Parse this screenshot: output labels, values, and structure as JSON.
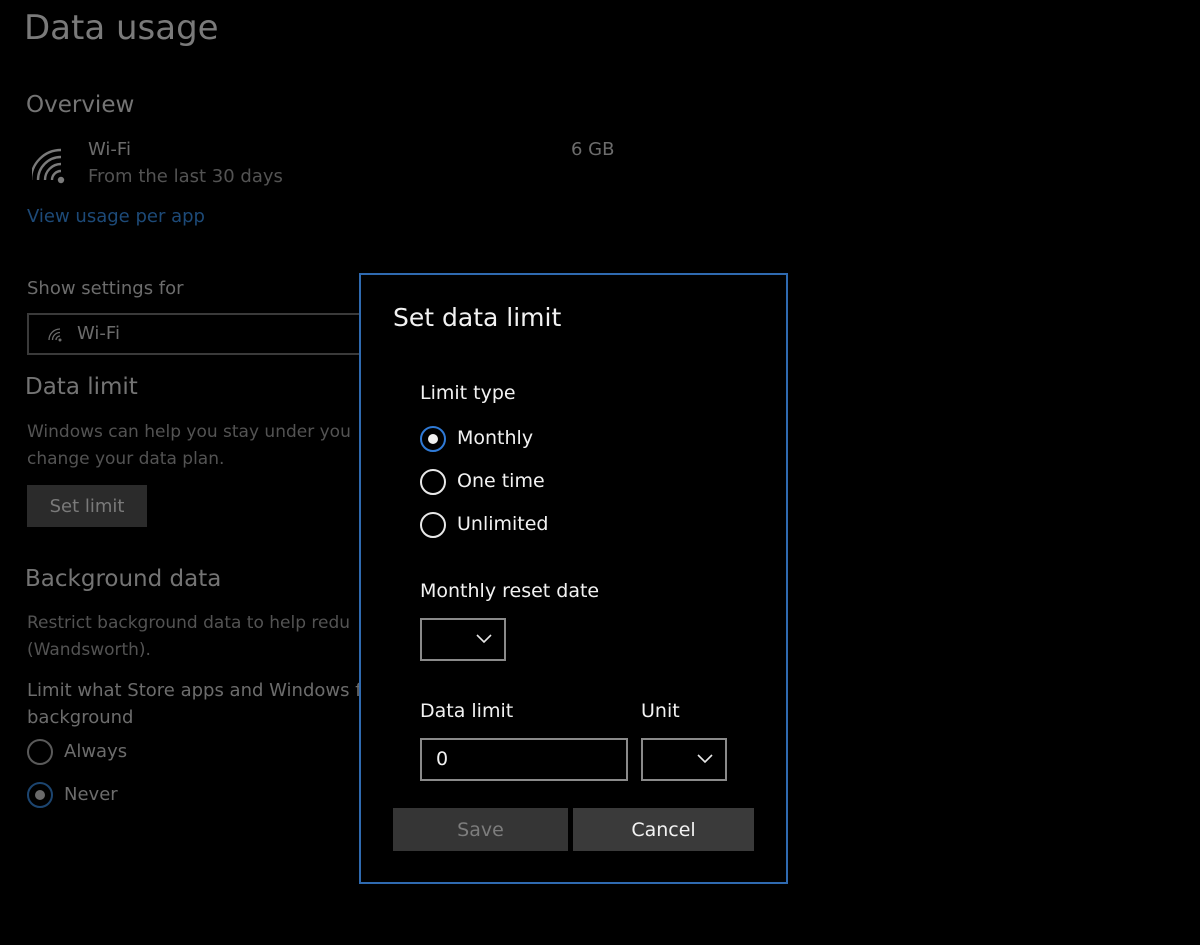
{
  "page": {
    "title": "Data usage",
    "overview_heading": "Overview",
    "wifi_name": "Wi-Fi",
    "wifi_period": "From the last 30 days",
    "wifi_usage": "6 GB",
    "view_usage_link": "View usage per app",
    "show_settings_label": "Show settings for",
    "network_dropdown_value": "Wi-Fi",
    "data_limit_heading": "Data limit",
    "data_limit_desc_line1": "Windows can help you stay under you",
    "data_limit_desc_line2": "change your data plan.",
    "set_limit_label": "Set limit",
    "background_heading": "Background data",
    "background_desc_line1": "Restrict background data to help redu",
    "background_desc_line2": "(Wandsworth).",
    "limit_store_line1": "Limit what Store apps and Windows fe",
    "limit_store_line2": "background",
    "options": [
      {
        "label": "Always",
        "checked": false
      },
      {
        "label": "Never",
        "checked": true
      }
    ]
  },
  "dialog": {
    "title": "Set data limit",
    "limit_type_label": "Limit type",
    "limit_types": [
      {
        "label": "Monthly",
        "checked": true
      },
      {
        "label": "One time",
        "checked": false
      },
      {
        "label": "Unlimited",
        "checked": false
      }
    ],
    "reset_date_label": "Monthly reset date",
    "reset_date_value": "",
    "data_limit_label": "Data limit",
    "data_limit_value": "0",
    "unit_label": "Unit",
    "unit_value": "",
    "save_label": "Save",
    "cancel_label": "Cancel"
  },
  "colors": {
    "accent": "#2f7ad6",
    "dialog_border": "#2f6ab0",
    "background": "#000000"
  }
}
